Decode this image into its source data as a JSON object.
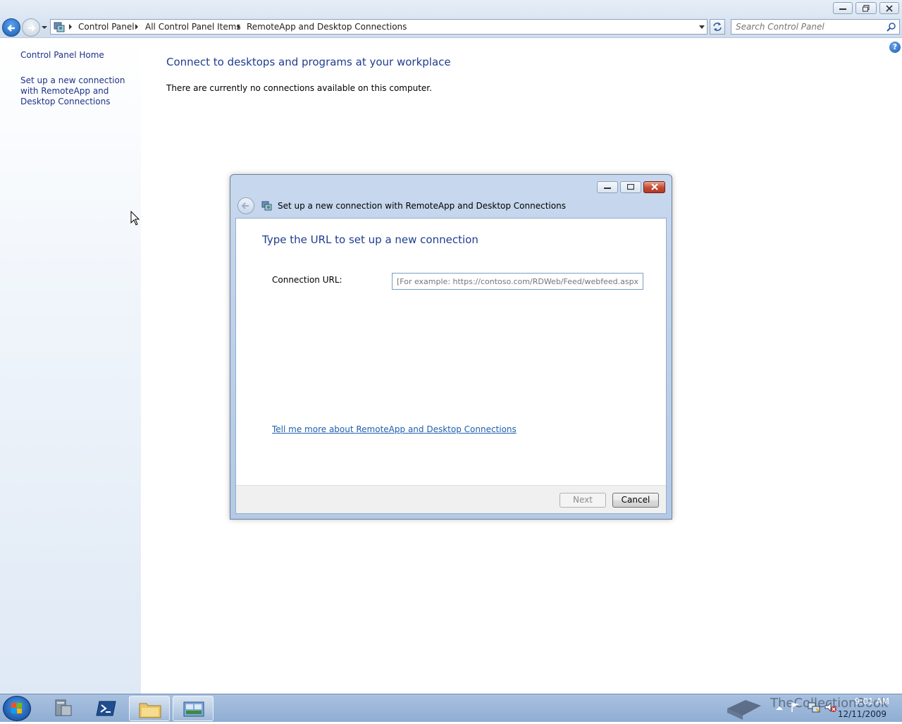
{
  "window": {
    "title": "RemoteApp and Desktop Connections"
  },
  "address_bar": {
    "crumbs": [
      "Control Panel",
      "All Control Panel Items",
      "RemoteApp and Desktop Connections"
    ],
    "search_placeholder": "Search Control Panel"
  },
  "left_pane": {
    "home_link": "Control Panel Home",
    "setup_link": "Set up a new connection with RemoteApp and Desktop Connections"
  },
  "content": {
    "title": "Connect to desktops and programs at your workplace",
    "message": "There are currently no connections available on this computer."
  },
  "dialog": {
    "title": "Set up a new connection with RemoteApp and Desktop Connections",
    "heading": "Type the URL to set up a new connection",
    "url_label": "Connection URL:",
    "url_placeholder": "[For example: https://contoso.com/RDWeb/Feed/webfeed.aspx]",
    "url_value": "",
    "more_link": "Tell me more about RemoteApp and Desktop Connections",
    "next_label": "Next",
    "cancel_label": "Cancel"
  },
  "taskbar": {
    "time": "9:01 AM",
    "date": "12/11/2009",
    "watermark": "TheCollectionBook",
    "pinned": [
      "server-manager-icon",
      "powershell-icon",
      "explorer-icon",
      "control-panel-icon"
    ]
  },
  "colors": {
    "link": "#1e3287",
    "heading": "#1e3d8f",
    "accent": "#1a5fb4"
  }
}
